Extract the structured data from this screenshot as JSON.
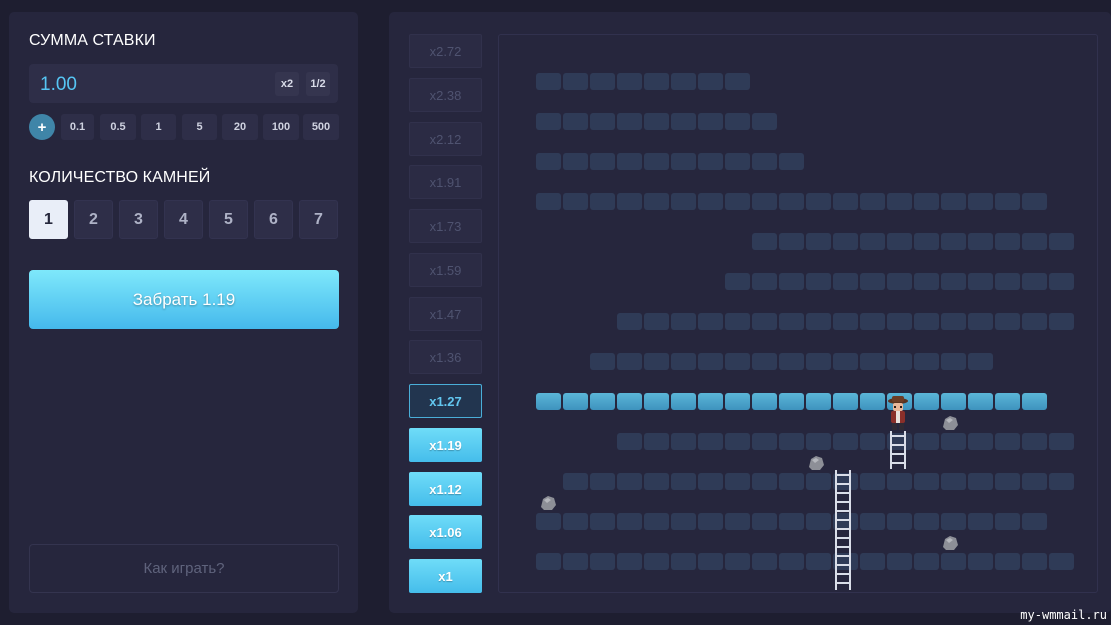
{
  "bet": {
    "title": "СУММА СТАВКИ",
    "value": "1.00",
    "double_label": "x2",
    "half_label": "1/2",
    "plus_label": "+",
    "chips": [
      "0.1",
      "0.5",
      "1",
      "5",
      "20",
      "100",
      "500"
    ]
  },
  "stones": {
    "title": "КОЛИЧЕСТВО КАМНЕЙ",
    "options": [
      "1",
      "2",
      "3",
      "4",
      "5",
      "6",
      "7"
    ],
    "selected": "1"
  },
  "cashout_label": "Забрать 1.19",
  "how_to_play_label": "Как играть?",
  "multipliers": [
    {
      "label": "x2.72",
      "state": "locked"
    },
    {
      "label": "x2.38",
      "state": "locked"
    },
    {
      "label": "x2.12",
      "state": "locked"
    },
    {
      "label": "x1.91",
      "state": "locked"
    },
    {
      "label": "x1.73",
      "state": "locked"
    },
    {
      "label": "x1.59",
      "state": "locked"
    },
    {
      "label": "x1.47",
      "state": "locked"
    },
    {
      "label": "x1.36",
      "state": "locked"
    },
    {
      "label": "x1.27",
      "state": "current"
    },
    {
      "label": "x1.19",
      "state": "passed"
    },
    {
      "label": "x1.12",
      "state": "passed"
    },
    {
      "label": "x1.06",
      "state": "passed"
    },
    {
      "label": "x1",
      "state": "passed"
    }
  ],
  "colors": {
    "accent": "#45bdeb",
    "bet_value": "#56c6f4",
    "tile": "#2f3b57",
    "tile_lit": "#4aa7cf",
    "background": "#1e1e30",
    "panel": "#26263d"
  },
  "icons": {
    "hero": "miner-hero-icon",
    "rock": "rock-icon",
    "ladder": "ladder-icon"
  },
  "watermark": "my-wmmail.ru"
}
